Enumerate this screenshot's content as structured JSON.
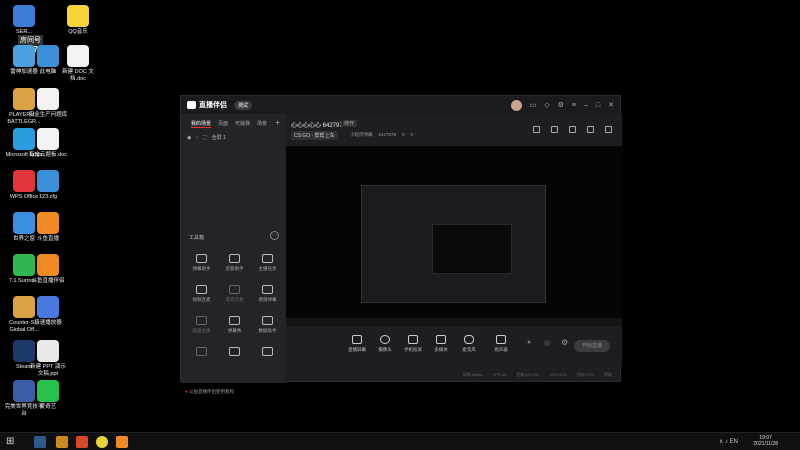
{
  "desktop": {
    "overlay_room": "房间号",
    "overlay_number": "6427970",
    "icons": [
      {
        "label": "SER...",
        "color": "#3c7bd6"
      },
      {
        "label": "QQ音乐",
        "color": "#f5d43b"
      },
      {
        "label": "雷神加速器",
        "color": "#4aa0e0"
      },
      {
        "label": "此电脑",
        "color": "#3b8fd8"
      },
      {
        "label": "新建 DOC 文档.doc",
        "color": "#f2f2f2"
      },
      {
        "label": "PLAYERU... BATTLEGR...",
        "color": "#d9a441"
      },
      {
        "label": "安全生产问题库",
        "color": "#f2f2f2"
      },
      {
        "label": "Microsoft Edge",
        "color": "#2a9ce0"
      },
      {
        "label": "有文云题板.doc",
        "color": "#f2f2f2"
      },
      {
        "label": "WPS Office",
        "color": "#e0353a"
      },
      {
        "label": "123.cfg",
        "color": "#3a8ed8"
      },
      {
        "label": "世界之窗",
        "color": "#3b8fe0"
      },
      {
        "label": "斗鱼直播",
        "color": "#f08a24"
      },
      {
        "label": "7.1 Surrou...",
        "color": "#2fb84f"
      },
      {
        "label": "斗鱼直播伴侣",
        "color": "#f08a24"
      },
      {
        "label": "Counter-S... Global Off...",
        "color": "#d9a441"
      },
      {
        "label": "极速播放器",
        "color": "#4a7ae0"
      },
      {
        "label": "Steam",
        "color": "#1b3a6a"
      },
      {
        "label": "新建 PPT 演示文稿.ppt",
        "color": "#e8e8e8"
      },
      {
        "label": "完美世界竞技平台",
        "color": "#3a5fa8"
      },
      {
        "label": "爱奇艺",
        "color": "#27c24a"
      }
    ]
  },
  "app": {
    "name": "直播伴侣",
    "version": "测试",
    "left_tabs": [
      "我的场景",
      "页面",
      "可操我",
      "场景"
    ],
    "left_tab_add": "+",
    "scene_label": "全屏 1",
    "toolbox_title": "工具箱",
    "toolbox_more": "···",
    "tools": [
      {
        "label": "弹幕助手",
        "dim": false
      },
      {
        "label": "房管助手",
        "dim": false
      },
      {
        "label": "主播任务",
        "dim": false
      },
      {
        "label": "视频连麦",
        "dim": false
      },
      {
        "label": "嘉宾连麦",
        "dim": true
      },
      {
        "label": "感谢弹幕",
        "dim": false
      },
      {
        "label": "超级主播",
        "dim": true
      },
      {
        "label": "弹幕秀",
        "dim": false
      },
      {
        "label": "数据助手",
        "dim": false
      },
      {
        "label": "",
        "dim": true
      },
      {
        "label": "",
        "dim": false
      },
      {
        "label": "",
        "dim": false
      }
    ],
    "notice_prefix": "●",
    "notice_text": "斗鱼直播伴侣使用教程",
    "room": {
      "name": "心心心心心 6427979",
      "tag": "待开",
      "category": "CS:GO · 帮帮上车",
      "stats": [
        "小程序弹幕",
        "6427979",
        "0",
        "0"
      ]
    },
    "bottom_buttons": [
      {
        "label": "直播屏幕"
      },
      {
        "label": "摄像头"
      },
      {
        "label": "手机投屏"
      },
      {
        "label": "多媒体"
      },
      {
        "label": "麦克风"
      },
      {
        "label": "扬声器"
      }
    ],
    "start_button": "开始直播",
    "status_items": [
      "码率:0kbps",
      "FPS:30",
      "丢帧:0(0.0%)",
      "CPU:12%",
      "内存:47%",
      "帮助"
    ]
  },
  "taskbar": {
    "time": "19:07",
    "date": "2021/11/28",
    "tray_text": "∧  ♪  EN"
  }
}
